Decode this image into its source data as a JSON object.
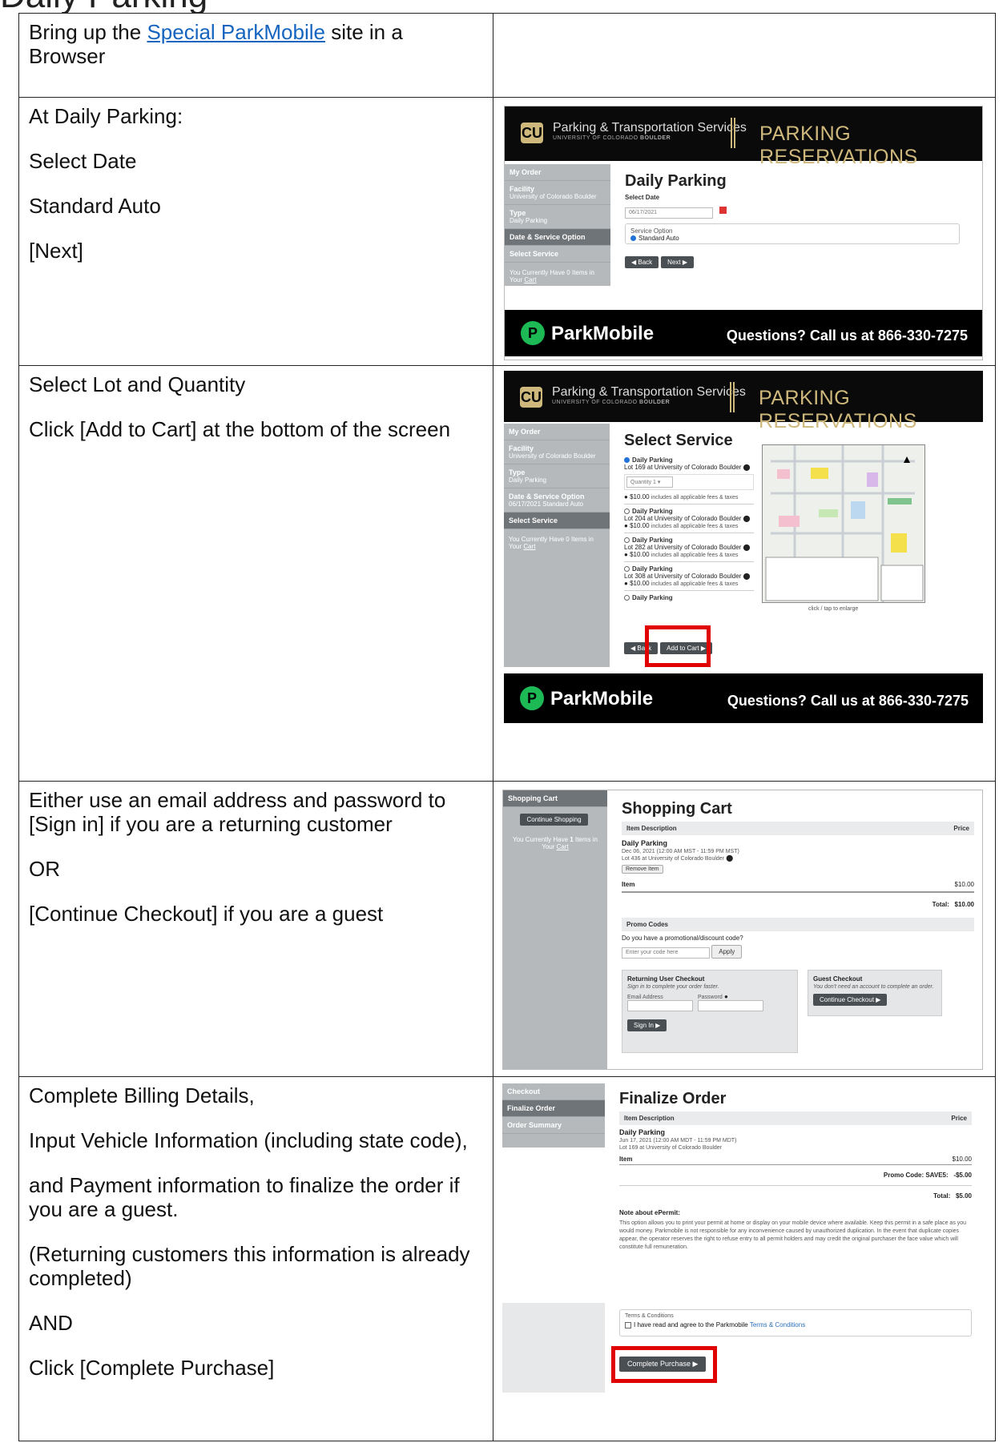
{
  "page_title_fragment": "Daily Parking",
  "rows": [
    {
      "text_before": "Bring up the ",
      "link": "Special ParkMobile",
      "text_after": " site in a Browser"
    },
    {
      "lines": [
        "At Daily Parking:",
        "Select Date",
        "Standard Auto",
        "[Next]"
      ]
    },
    {
      "lines": [
        "Select Lot and Quantity",
        "Click [Add to Cart] at the bottom of the screen"
      ]
    },
    {
      "lines": [
        "Either use an email address and password to [Sign in] if you are a returning customer",
        "OR",
        "[Continue Checkout] if you are a guest"
      ]
    },
    {
      "lines": [
        "Complete Billing Details,",
        "Input Vehicle Information (including state code),",
        "and Payment information to finalize the order if you are a guest.",
        "(Returning customers this information is already completed)",
        "AND",
        "Click [Complete Purchase]"
      ]
    }
  ],
  "header": {
    "logo": "CU",
    "dept": "Parking & Transportation Services",
    "univ_prefix": "UNIVERSITY OF COLORADO",
    "univ_bold": "BOULDER",
    "banner": "PARKING RESERVATIONS"
  },
  "footer": {
    "brand": "ParkMobile",
    "brand_icon": "P",
    "phone": "Questions? Call us at 866-330-7275"
  },
  "shot1": {
    "sidebar": [
      {
        "label": "My Order",
        "sub": ""
      },
      {
        "label": "Facility",
        "sub": "University of Colorado Boulder"
      },
      {
        "label": "Type",
        "sub": "Daily Parking"
      },
      {
        "label": "Date & Service Option",
        "sub": ""
      },
      {
        "label": "Select Service",
        "sub": ""
      }
    ],
    "cart_note_pre": "You Currently Have 0 Items in Your ",
    "cart_link": "Cart",
    "heading": "Daily Parking",
    "select_date_label": "Select Date",
    "date_value": "06/17/2021",
    "service_option_label": "Service Option",
    "service_option": "Standard Auto",
    "back": "Back",
    "next": "Next"
  },
  "shot2": {
    "sidebar": [
      {
        "label": "My Order",
        "sub": ""
      },
      {
        "label": "Facility",
        "sub": "University of Colorado Boulder"
      },
      {
        "label": "Type",
        "sub": "Daily Parking"
      },
      {
        "label": "Date & Service Option",
        "sub": "06/17/2021 Standard Auto"
      },
      {
        "label": "Select Service",
        "sub": ""
      }
    ],
    "cart_note_pre": "You Currently Have 0 Items in Your ",
    "cart_link": "Cart",
    "heading": "Select Service",
    "lots": [
      {
        "name": "Daily Parking",
        "lot": "Lot 169 at University of Colorado Boulder",
        "price": "$10.00",
        "fees": "includes all applicable fees & taxes",
        "selected": true
      },
      {
        "name": "Daily Parking",
        "lot": "Lot 204 at University of Colorado Boulder",
        "price": "$10.00",
        "fees": "includes all applicable fees & taxes",
        "selected": false
      },
      {
        "name": "Daily Parking",
        "lot": "Lot 282 at University of Colorado Boulder",
        "price": "$10.00",
        "fees": "includes all applicable fees & taxes",
        "selected": false
      },
      {
        "name": "Daily Parking",
        "lot": "Lot 308 at University of Colorado Boulder",
        "price": "$10.00",
        "fees": "includes all applicable fees & taxes",
        "selected": false
      },
      {
        "name": "Daily Parking",
        "lot": "",
        "price": "",
        "fees": "",
        "selected": false
      }
    ],
    "quantity_label": "Quantity",
    "quantity_value": "1",
    "map_caption": "click / tap to enlarge",
    "back": "Back",
    "add_to_cart": "Add to Cart"
  },
  "shot3": {
    "side_title": "Shopping Cart",
    "continue_shopping": "Continue Shopping",
    "cart_note_pre": "You Currently Have ",
    "cart_count": "1",
    "cart_note_post": " Items in Your ",
    "cart_link": "Cart",
    "heading": "Shopping Cart",
    "col_desc": "Item Description",
    "col_price": "Price",
    "item_name": "Daily Parking",
    "item_date": "Dec 06, 2021 (12:00 AM MST - 11:59 PM MST)",
    "item_lot": "Lot 436 at University of Colorado Boulder",
    "remove": "Remove Item",
    "item_label": "Item",
    "item_price": "$10.00",
    "total_label": "Total:",
    "total_value": "$10.00",
    "promo_title": "Promo Codes",
    "promo_question": "Do you have a promotional/discount code?",
    "promo_placeholder": "Enter your code here",
    "apply": "Apply",
    "returning_title": "Returning User Checkout",
    "returning_sub": "Sign in to complete your order faster.",
    "email_label": "Email Address",
    "password_label": "Password",
    "sign_in": "Sign In",
    "guest_title": "Guest Checkout",
    "guest_sub": "You don't need an account to complete an order.",
    "continue_checkout": "Continue Checkout"
  },
  "shot4": {
    "sidebar": [
      "Checkout",
      "Finalize Order",
      "Order Summary"
    ],
    "heading": "Finalize Order",
    "col_desc": "Item Description",
    "col_price": "Price",
    "item_name": "Daily Parking",
    "item_date": "Jun 17, 2021 (12:00 AM MDT - 11:59 PM MDT)",
    "item_lot": "Lot 169 at University of Colorado Boulder",
    "item_label": "Item",
    "item_price": "$10.00",
    "promo_label": "Promo Code: SAVE5:",
    "promo_value": "-$5.00",
    "total_label": "Total:",
    "total_value": "$5.00",
    "note_title": "Note about ePermit:",
    "note_text": "This option allows you to print your permit at home or display on your mobile device where available. Keep this permit in a safe place as you would money. Parkmobile is not responsible for any inconvenience caused by unauthorized duplication. In the event that duplicate copies appear, the operator reserves the right to refuse entry to all permit holders and may credit the original purchaser the face value which will constitute full remuneration.",
    "terms_title": "Terms & Conditions",
    "terms_text": "I have read and agree to the Parkmobile ",
    "terms_link": "Terms & Conditions",
    "complete_purchase": "Complete Purchase"
  }
}
